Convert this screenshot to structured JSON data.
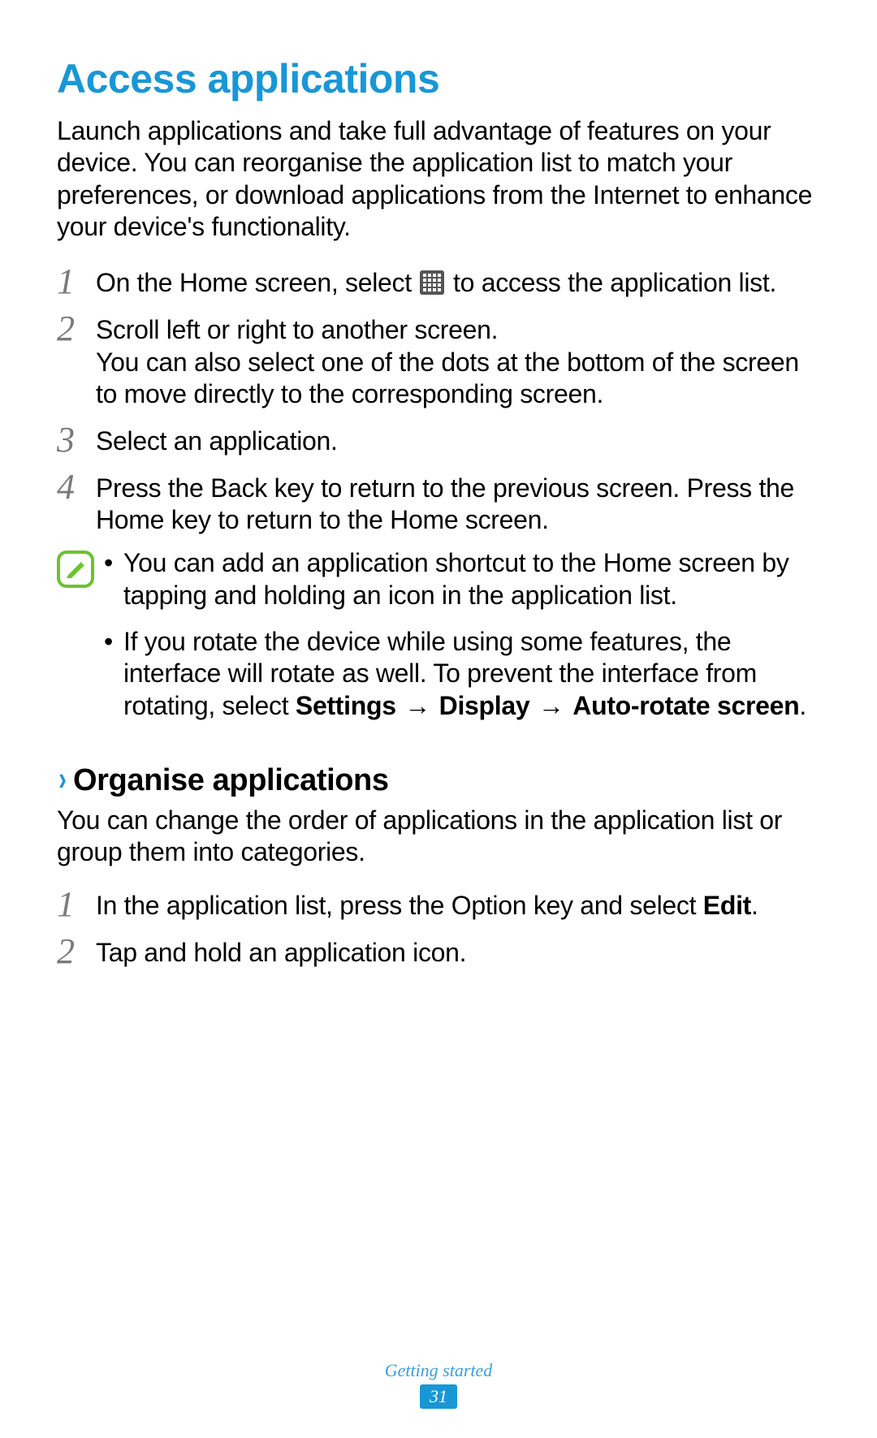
{
  "heading": "Access applications",
  "intro": "Launch applications and take full advantage of features on your device. You can reorganise the application list to match your preferences, or download applications from the Internet to enhance your device's functionality.",
  "steps": [
    {
      "num": "1",
      "before": "On the Home screen, select ",
      "after": " to access the application list."
    },
    {
      "num": "2",
      "line1": "Scroll left or right to another screen.",
      "line2": "You can also select one of the dots at the bottom of the screen to move directly to the corresponding screen."
    },
    {
      "num": "3",
      "text": "Select an application."
    },
    {
      "num": "4",
      "text": "Press the Back key to return to the previous screen. Press the Home key to return to the Home screen."
    }
  ],
  "notes": {
    "bullet1": "You can add an application shortcut to the Home screen by tapping and holding an icon in the application list.",
    "bullet2_pre": "If you rotate the device while using some features, the interface will rotate as well. To prevent the interface from rotating, select ",
    "bullet2_b1": "Settings",
    "bullet2_arrow": " → ",
    "bullet2_b2": "Display",
    "bullet2_b3": "Auto-rotate screen",
    "bullet2_post": "."
  },
  "sub": {
    "title": "Organise applications",
    "intro": "You can change the order of applications in the application list or group them into categories.",
    "step1_pre": "In the application list, press the Option key and select ",
    "step1_bold": "Edit",
    "step1_post": ".",
    "step2": "Tap and hold an application icon."
  },
  "footer": {
    "section": "Getting started",
    "page": "31"
  }
}
